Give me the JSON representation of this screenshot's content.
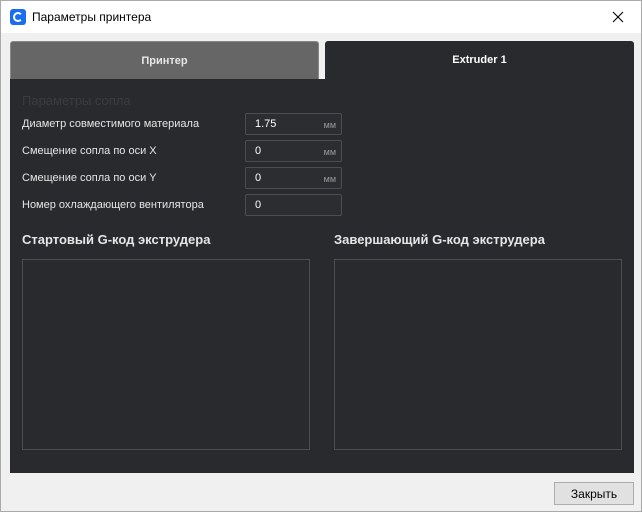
{
  "window": {
    "title": "Параметры принтера",
    "icon": "cura-app-icon"
  },
  "tabs": [
    {
      "label": "Принтер",
      "active": false
    },
    {
      "label": "Extruder 1",
      "active": true
    }
  ],
  "extruder": {
    "section_title": "Параметры сопла",
    "fields": [
      {
        "label": "Диаметр совместимого материала",
        "value": "1.75",
        "unit": "мм"
      },
      {
        "label": "Смещение сопла по оси X",
        "value": "0",
        "unit": "мм"
      },
      {
        "label": "Смещение сопла по оси Y",
        "value": "0",
        "unit": "мм"
      },
      {
        "label": "Номер охлаждающего вентилятора",
        "value": "0",
        "unit": ""
      }
    ],
    "start_gcode_title": "Стартовый G-код экструдера",
    "end_gcode_title": "Завершающий G-код экструдера",
    "start_gcode": "",
    "end_gcode": ""
  },
  "footer": {
    "close_label": "Закрыть"
  },
  "colors": {
    "panel_bg": "#282a2e",
    "inactive_tab": "#666666",
    "accent": "#196ef0"
  }
}
